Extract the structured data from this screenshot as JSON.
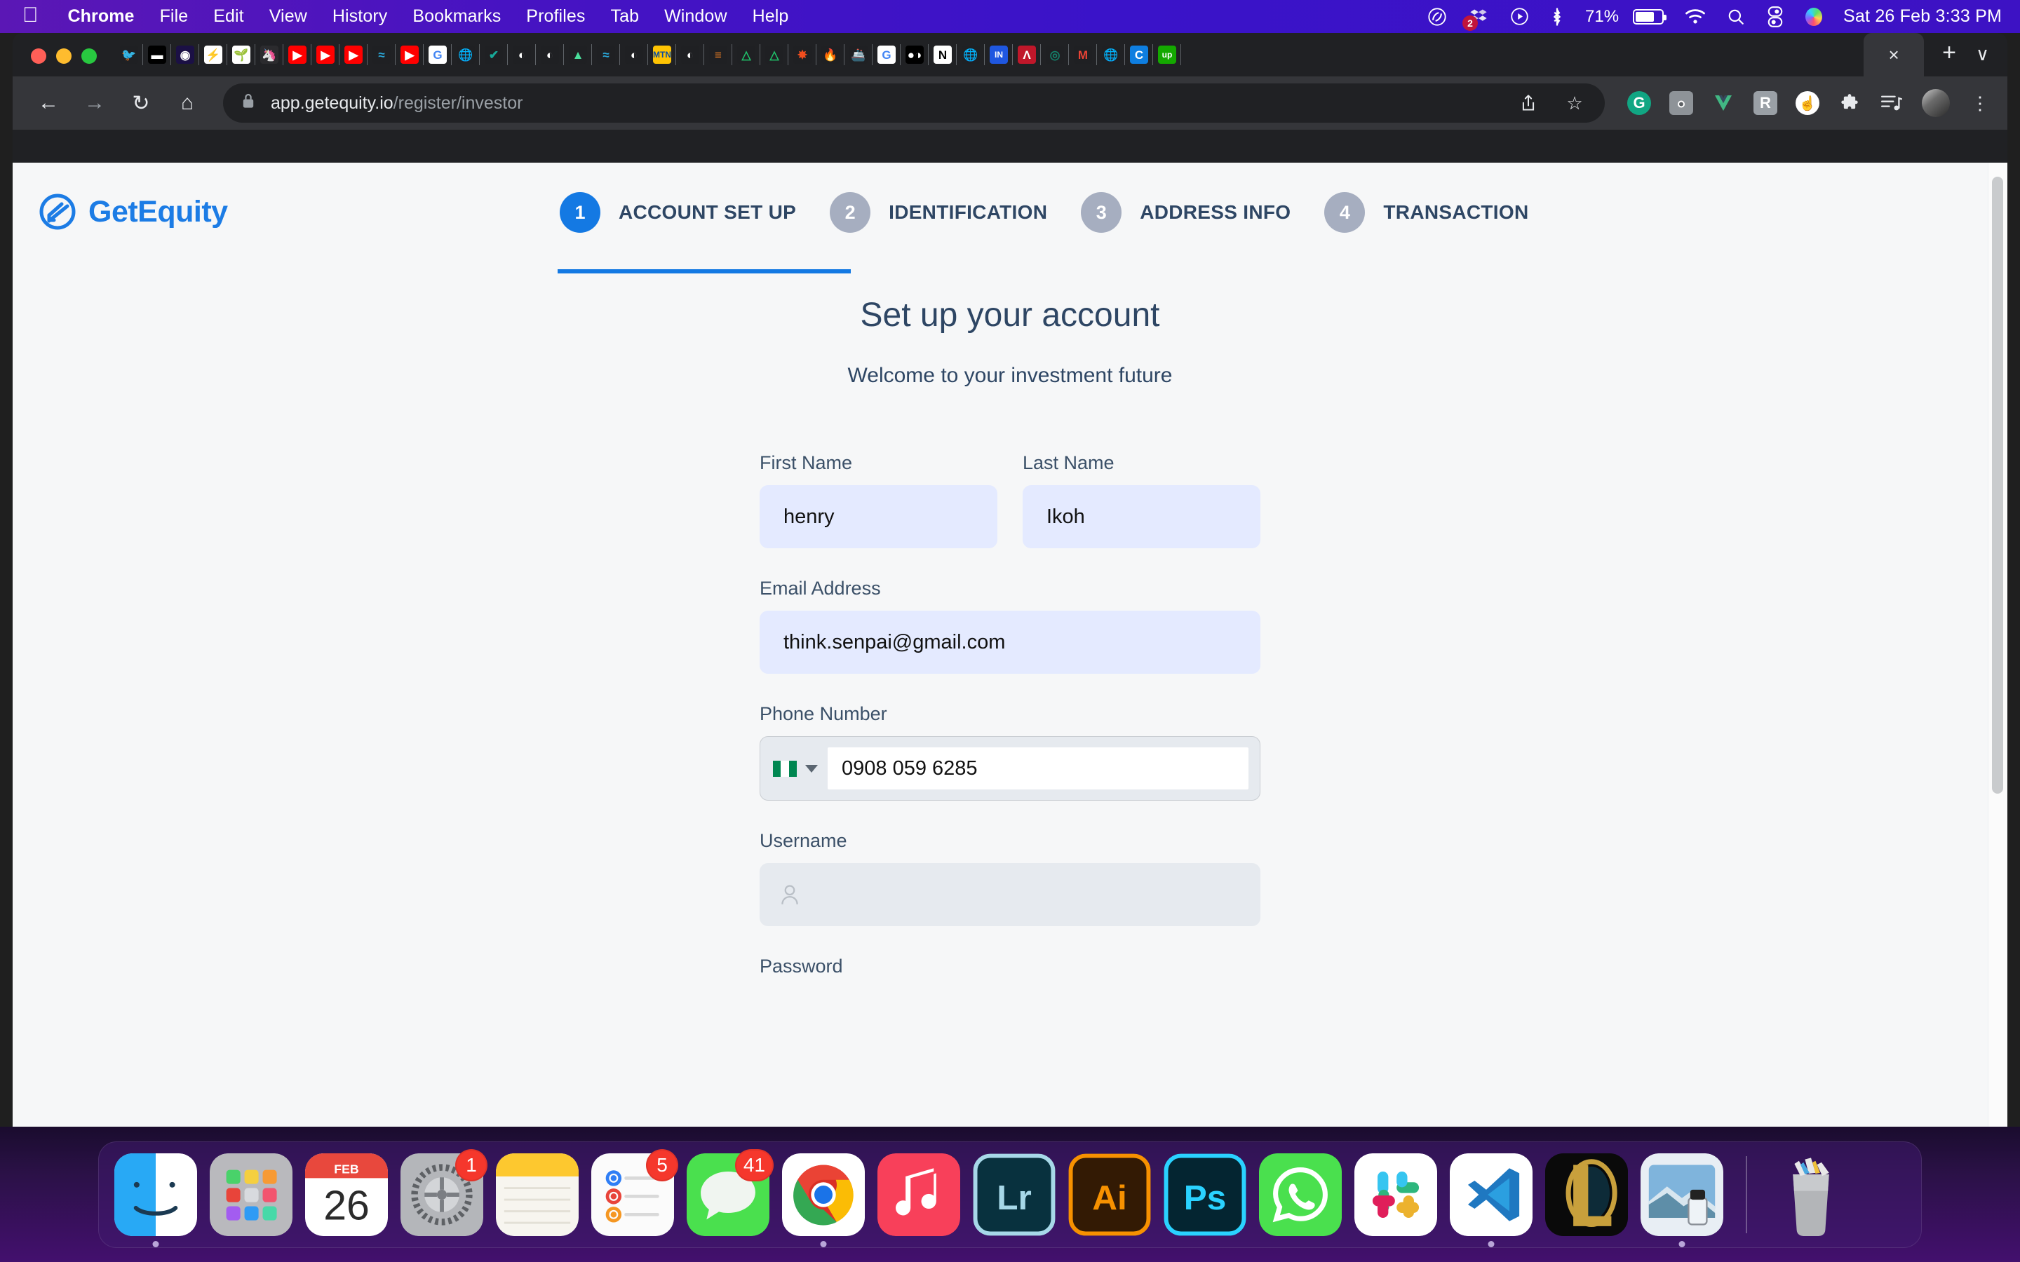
{
  "menubar": {
    "apple": "apple-logo",
    "items": [
      "Chrome",
      "File",
      "Edit",
      "View",
      "History",
      "Bookmarks",
      "Profiles",
      "Tab",
      "Window",
      "Help"
    ],
    "status": {
      "creative_cloud": "creative-cloud-icon",
      "dropbox_badge": "2",
      "battery_percent": "71%",
      "clock": "Sat 26 Feb  3:33 PM"
    }
  },
  "browser": {
    "tabs": [
      {
        "name": "twitter",
        "glyph": "🐦",
        "bg": "#1f2023",
        "color": "#1d9bf0"
      },
      {
        "name": "dark-site",
        "glyph": "▬",
        "bg": "#000000",
        "color": "#ffffff"
      },
      {
        "name": "obsidian",
        "glyph": "◉",
        "bg": "#1b1045",
        "color": "#ffffff"
      },
      {
        "name": "bolt",
        "glyph": "⚡",
        "bg": "#ffffff",
        "color": "#1dbf63"
      },
      {
        "name": "plant",
        "glyph": "🌱",
        "bg": "#ffffff",
        "color": "#16a34a"
      },
      {
        "name": "unicorn",
        "glyph": "🦄",
        "bg": "#2b2b2e",
        "color": "#b07cf0"
      },
      {
        "name": "youtube-1",
        "glyph": "▶",
        "bg": "#ff0000",
        "color": "#ffffff"
      },
      {
        "name": "youtube-2",
        "glyph": "▶",
        "bg": "#ff0000",
        "color": "#ffffff"
      },
      {
        "name": "youtube-3",
        "glyph": "▶",
        "bg": "#ff0000",
        "color": "#ffffff"
      },
      {
        "name": "supabase",
        "glyph": "≈",
        "bg": "#1f2023",
        "color": "#2aa7d8"
      },
      {
        "name": "youtube-4",
        "glyph": "▶",
        "bg": "#ff0000",
        "color": "#ffffff"
      },
      {
        "name": "google-1",
        "glyph": "G",
        "bg": "#ffffff",
        "color": "#4285f4"
      },
      {
        "name": "globe-1",
        "glyph": "🌐",
        "bg": "#1f2023",
        "color": "#9aa0a6"
      },
      {
        "name": "tick-green",
        "glyph": "✔",
        "bg": "#1f2023",
        "color": "#18a999"
      },
      {
        "name": "github-1",
        "glyph": "◐",
        "bg": "#1f2023",
        "color": "#ffffff"
      },
      {
        "name": "github-2",
        "glyph": "◐",
        "bg": "#1f2023",
        "color": "#ffffff"
      },
      {
        "name": "vercel-green",
        "glyph": "▲",
        "bg": "#1f2023",
        "color": "#4ade9b"
      },
      {
        "name": "supabase-2",
        "glyph": "≈",
        "bg": "#1f2023",
        "color": "#2aa7d8"
      },
      {
        "name": "github-3",
        "glyph": "◐",
        "bg": "#1f2023",
        "color": "#ffffff"
      },
      {
        "name": "mtn",
        "glyph": "MTN",
        "bg": "#ffc403",
        "color": "#0b4da2"
      },
      {
        "name": "github-4",
        "glyph": "◐",
        "bg": "#1f2023",
        "color": "#ffffff"
      },
      {
        "name": "stackoverflow",
        "glyph": "≡",
        "bg": "#1f2023",
        "color": "#f48024"
      },
      {
        "name": "netlify-1",
        "glyph": "△",
        "bg": "#1f2023",
        "color": "#20c36b"
      },
      {
        "name": "netlify-2",
        "glyph": "△",
        "bg": "#1f2023",
        "color": "#20c36b"
      },
      {
        "name": "figma",
        "glyph": "✸",
        "bg": "#1f2023",
        "color": "#f24e1e"
      },
      {
        "name": "firebase",
        "glyph": "🔥",
        "bg": "#1f2023",
        "color": "#ffa000"
      },
      {
        "name": "ship",
        "glyph": "🚢",
        "bg": "#1f2023",
        "color": "#d94141"
      },
      {
        "name": "google-2",
        "glyph": "G",
        "bg": "#ffffff",
        "color": "#4285f4"
      },
      {
        "name": "medium",
        "glyph": "●◑",
        "bg": "#000000",
        "color": "#ffffff"
      },
      {
        "name": "notion",
        "glyph": "N",
        "bg": "#ffffff",
        "color": "#000000"
      },
      {
        "name": "globe-2",
        "glyph": "🌐",
        "bg": "#1f2023",
        "color": "#9aa0a6"
      },
      {
        "name": "insider",
        "glyph": "IN",
        "bg": "#1f57e0",
        "color": "#ffffff"
      },
      {
        "name": "redline",
        "glyph": "Λ",
        "bg": "#c0172a",
        "color": "#ffffff"
      },
      {
        "name": "bank",
        "glyph": "◎",
        "bg": "#1f2023",
        "color": "#14806a"
      },
      {
        "name": "gmail",
        "glyph": "M",
        "bg": "#1f2023",
        "color": "#ea4335"
      },
      {
        "name": "globe-3",
        "glyph": "🌐",
        "bg": "#1f2023",
        "color": "#9aa0a6"
      },
      {
        "name": "c-blue",
        "glyph": "C",
        "bg": "#0e7ee0",
        "color": "#ffffff"
      },
      {
        "name": "upwork",
        "glyph": "up",
        "bg": "#14a800",
        "color": "#ffffff"
      }
    ],
    "active_tab_close": "×",
    "new_tab": "+",
    "tab_list_chevron": "∨",
    "nav": {
      "back": "←",
      "forward": "→",
      "reload": "↻",
      "home": "⌂"
    },
    "omnibox": {
      "lock": "lock-icon",
      "host": "app.getequity.io",
      "path": "/register/investor"
    },
    "toolbar_actions": {
      "share": "⤴",
      "bookmark": "☆",
      "grammarly": "G",
      "camera": "◉",
      "vue": "V",
      "r_ext": "R",
      "cursor_ext": "☝",
      "extensions_puzzle": "🧩",
      "reading_list": "≡",
      "profile_avatar": "avatar-icon",
      "menu_kebab": "⋮"
    }
  },
  "app": {
    "brand": "GetEquity",
    "steps": [
      {
        "num": "1",
        "label": "ACCOUNT SET UP",
        "active": true
      },
      {
        "num": "2",
        "label": "IDENTIFICATION",
        "active": false
      },
      {
        "num": "3",
        "label": "ADDRESS INFO",
        "active": false
      },
      {
        "num": "4",
        "label": "TRANSACTION",
        "active": false
      }
    ],
    "heading": "Set up your account",
    "subheading": "Welcome to your investment future",
    "form": {
      "first_name": {
        "label": "First Name",
        "value": "henry",
        "placeholder": ""
      },
      "last_name": {
        "label": "Last Name",
        "value": "Ikoh",
        "placeholder": ""
      },
      "email": {
        "label": "Email Address",
        "value": "think.senpai@gmail.com",
        "placeholder": ""
      },
      "phone": {
        "label": "Phone Number",
        "value": "0908 059 6285",
        "placeholder": "",
        "country_flag": "nigeria-flag-icon"
      },
      "username": {
        "label": "Username",
        "value": "",
        "placeholder": ""
      },
      "password": {
        "label": "Password"
      }
    },
    "colors": {
      "accent": "#1479e3",
      "text": "#2e4664",
      "field_filled": "#e4eaff",
      "field_empty": "#e6eaef",
      "page_bg": "#f6f7f8"
    }
  },
  "dock": {
    "items": [
      {
        "name": "finder",
        "badge": "",
        "running": true
      },
      {
        "name": "launchpad",
        "badge": "",
        "running": false
      },
      {
        "name": "calendar",
        "badge": "",
        "running": false,
        "month": "FEB",
        "day": "26"
      },
      {
        "name": "system-preferences",
        "badge": "1",
        "running": false
      },
      {
        "name": "notes",
        "badge": "",
        "running": false
      },
      {
        "name": "reminders",
        "badge": "5",
        "running": false
      },
      {
        "name": "messages",
        "badge": "41",
        "running": false
      },
      {
        "name": "google-chrome",
        "badge": "",
        "running": true
      },
      {
        "name": "music",
        "badge": "",
        "running": false
      },
      {
        "name": "lightroom",
        "badge": "",
        "running": false,
        "glyph": "Lr"
      },
      {
        "name": "illustrator",
        "badge": "",
        "running": false,
        "glyph": "Ai"
      },
      {
        "name": "photoshop",
        "badge": "",
        "running": false,
        "glyph": "Ps"
      },
      {
        "name": "whatsapp",
        "badge": "",
        "running": false
      },
      {
        "name": "slack",
        "badge": "",
        "running": false
      },
      {
        "name": "visual-studio-code",
        "badge": "",
        "running": true
      },
      {
        "name": "league-of-legends",
        "badge": "",
        "running": false,
        "glyph": "L"
      },
      {
        "name": "preview",
        "badge": "",
        "running": true
      },
      {
        "name": "trash",
        "badge": "",
        "running": false
      }
    ]
  }
}
